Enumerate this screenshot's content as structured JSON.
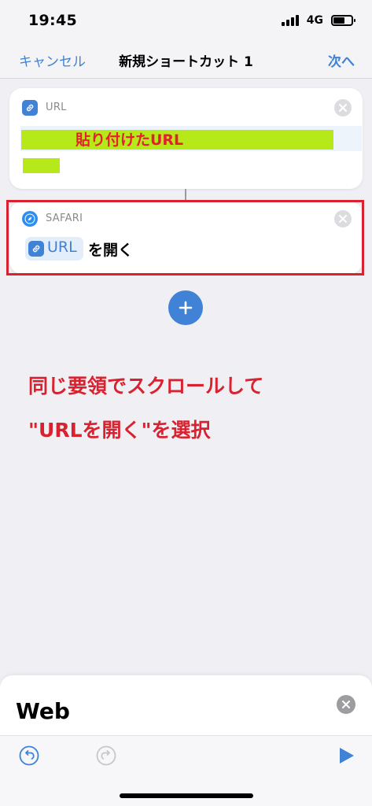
{
  "status": {
    "time": "19:45",
    "network": "4G"
  },
  "nav": {
    "cancel_label": "キャンセル",
    "title": "新規ショートカット 1",
    "next_label": "次へ"
  },
  "actions": {
    "url": {
      "label": "URL",
      "annotation": "貼り付けたURL"
    },
    "safari": {
      "label": "SAFARI",
      "token": "URL",
      "action_text": "を開く"
    }
  },
  "instruction": {
    "line1": "同じ要領でスクロールして",
    "line2": "\"URLを開く\"を選択"
  },
  "bottom_panel": {
    "title": "Web"
  },
  "colors": {
    "accent": "#3f82d6",
    "annotation_red": "#d9222f",
    "highlight": "#b6e81a"
  },
  "icons": [
    "link-icon",
    "compass-icon",
    "close-icon",
    "plus-icon",
    "undo-icon",
    "redo-icon",
    "play-icon"
  ]
}
